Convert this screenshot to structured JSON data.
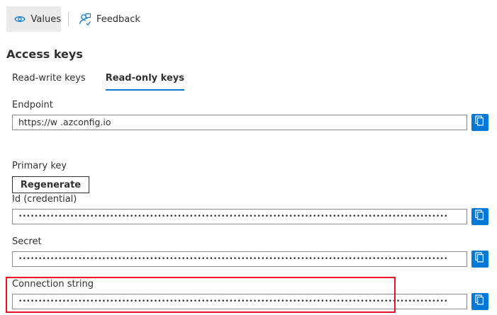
{
  "toolbar": {
    "values_label": "Values",
    "feedback_label": "Feedback"
  },
  "section_title": "Access keys",
  "tabs": [
    {
      "label": "Read-write keys",
      "active": false
    },
    {
      "label": "Read-only keys",
      "active": true
    }
  ],
  "endpoint": {
    "label": "Endpoint",
    "value": "https://w                    .azconfig.io"
  },
  "primary_key": {
    "heading": "Primary key",
    "regenerate_label": "Regenerate",
    "id": {
      "label": "Id (credential)",
      "value": "••••••••••••••••••••••••••••••••••••••••••••••••••••••••••••••••••••••••••••••••••••••••••••••••••••••••••••"
    },
    "secret": {
      "label": "Secret",
      "value": "••••••••••••••••••••••••••••••••••••••••••••••••••••••••••••••••••••••••••••••••••••••••••••••••••••••••••••"
    },
    "connection_string": {
      "label": "Connection string",
      "value": "••••••••••••••••••••••••••••••••••••••••••••••••••••••••••••••••••••••••••••••••••••••••••••••••••••••••••••"
    }
  },
  "colors": {
    "accent": "#0078d4",
    "highlight": "#e81123",
    "toolbar_selected_bg": "#edebe9"
  },
  "icons": {
    "values": "eye-icon",
    "feedback": "feedback-person-icon",
    "copy": "copy-icon"
  }
}
